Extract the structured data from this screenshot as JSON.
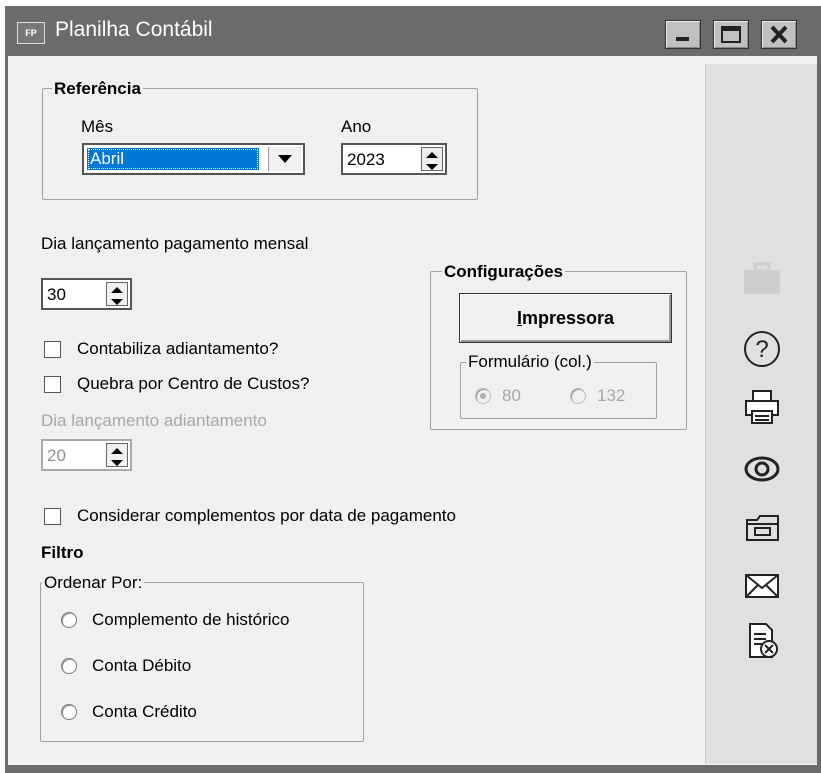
{
  "window": {
    "title": "Planilha Contábil",
    "app_icon_text": "FP",
    "controls": [
      "minimize-icon",
      "maximize-icon",
      "close-icon"
    ]
  },
  "referencia": {
    "legend": "Referência",
    "mes_label": "Mês",
    "mes_value": "Abril",
    "ano_label": "Ano",
    "ano_value": "2023"
  },
  "dia_lancamento": {
    "label": "Dia lançamento pagamento mensal",
    "value": "30"
  },
  "checkboxes": {
    "contabiliza": "Contabiliza adiantamento?",
    "quebra": "Quebra por Centro de Custos?",
    "considerar": "Considerar complementos por data de pagamento"
  },
  "dia_adiantamento": {
    "label": "Dia lançamento adiantamento",
    "value": "20"
  },
  "configuracoes": {
    "legend": "Configurações",
    "button_first": "I",
    "button_rest": "mpressora",
    "formulario_legend": "Formulário (col.)",
    "opt_80": "80",
    "opt_132": "132"
  },
  "filtro": {
    "title": "Filtro",
    "ordenar_legend": "Ordenar Por:",
    "options": [
      "Complemento de histórico",
      "Conta Débito",
      "Conta Crédito"
    ]
  },
  "sidebar_icons": [
    "briefcase-icon",
    "help-icon",
    "print-icon",
    "preview-icon",
    "folder-icon",
    "email-icon",
    "cancel-document-icon"
  ],
  "colors": {
    "titlebar": "#6b6b6b",
    "selection": "#0078d7",
    "panel": "#f0f0f0"
  }
}
